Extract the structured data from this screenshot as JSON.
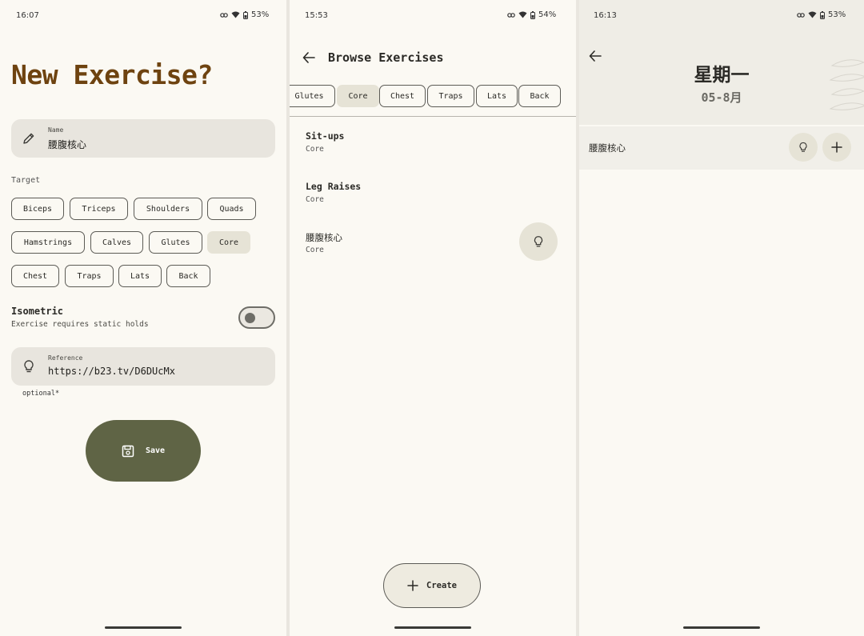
{
  "panel1": {
    "status": {
      "time": "16:07",
      "battery": "53%"
    },
    "title": "New Exercise?",
    "name_field": {
      "label": "Name",
      "value": "腰腹核心"
    },
    "target_label": "Target",
    "targets": [
      "Biceps",
      "Triceps",
      "Shoulders",
      "Quads",
      "Hamstrings",
      "Calves",
      "Glutes",
      "Core",
      "Chest",
      "Traps",
      "Lats",
      "Back"
    ],
    "selected_target": "Core",
    "isometric": {
      "title": "Isometric",
      "subtitle": "Exercise requires static holds",
      "enabled": false
    },
    "reference_field": {
      "label": "Reference",
      "value": "https://b23.tv/D6DUcMx"
    },
    "optional_note": "optional*",
    "save_label": "Save",
    "accent_color": "#6e4310",
    "button_color": "#5f6445"
  },
  "panel2": {
    "status": {
      "time": "15:53",
      "battery": "54%"
    },
    "title": "Browse Exercises",
    "tabs": [
      "Glutes",
      "Core",
      "Chest",
      "Traps",
      "Lats",
      "Back"
    ],
    "selected_tab": "Core",
    "exercises": [
      {
        "name": "Sit-ups",
        "category": "Core"
      },
      {
        "name": "Leg Raises",
        "category": "Core"
      },
      {
        "name": "腰腹核心",
        "category": "Core"
      }
    ],
    "create_label": "Create"
  },
  "panel3": {
    "status": {
      "time": "16:13",
      "battery": "53%"
    },
    "weekday": "星期一",
    "date": "05-8月",
    "row_label": "腰腹核心"
  }
}
